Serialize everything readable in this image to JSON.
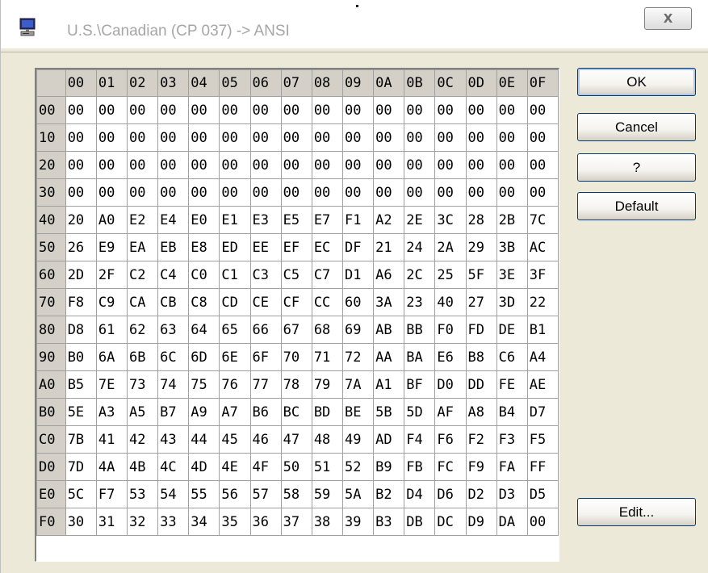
{
  "window": {
    "title": "U.S.\\Canadian (CP 037) -> ANSI",
    "close_label": "X"
  },
  "buttons": {
    "ok": "OK",
    "cancel": "Cancel",
    "help": "?",
    "default": "Default",
    "edit": "Edit..."
  },
  "grid": {
    "columns": [
      "00",
      "01",
      "02",
      "03",
      "04",
      "05",
      "06",
      "07",
      "08",
      "09",
      "0A",
      "0B",
      "0C",
      "0D",
      "0E",
      "0F"
    ],
    "rows": [
      {
        "label": "00",
        "cells": [
          "00",
          "00",
          "00",
          "00",
          "00",
          "00",
          "00",
          "00",
          "00",
          "00",
          "00",
          "00",
          "00",
          "00",
          "00",
          "00"
        ]
      },
      {
        "label": "10",
        "cells": [
          "00",
          "00",
          "00",
          "00",
          "00",
          "00",
          "00",
          "00",
          "00",
          "00",
          "00",
          "00",
          "00",
          "00",
          "00",
          "00"
        ]
      },
      {
        "label": "20",
        "cells": [
          "00",
          "00",
          "00",
          "00",
          "00",
          "00",
          "00",
          "00",
          "00",
          "00",
          "00",
          "00",
          "00",
          "00",
          "00",
          "00"
        ]
      },
      {
        "label": "30",
        "cells": [
          "00",
          "00",
          "00",
          "00",
          "00",
          "00",
          "00",
          "00",
          "00",
          "00",
          "00",
          "00",
          "00",
          "00",
          "00",
          "00"
        ]
      },
      {
        "label": "40",
        "cells": [
          "20",
          "A0",
          "E2",
          "E4",
          "E0",
          "E1",
          "E3",
          "E5",
          "E7",
          "F1",
          "A2",
          "2E",
          "3C",
          "28",
          "2B",
          "7C"
        ]
      },
      {
        "label": "50",
        "cells": [
          "26",
          "E9",
          "EA",
          "EB",
          "E8",
          "ED",
          "EE",
          "EF",
          "EC",
          "DF",
          "21",
          "24",
          "2A",
          "29",
          "3B",
          "AC"
        ]
      },
      {
        "label": "60",
        "cells": [
          "2D",
          "2F",
          "C2",
          "C4",
          "C0",
          "C1",
          "C3",
          "C5",
          "C7",
          "D1",
          "A6",
          "2C",
          "25",
          "5F",
          "3E",
          "3F"
        ]
      },
      {
        "label": "70",
        "cells": [
          "F8",
          "C9",
          "CA",
          "CB",
          "C8",
          "CD",
          "CE",
          "CF",
          "CC",
          "60",
          "3A",
          "23",
          "40",
          "27",
          "3D",
          "22"
        ]
      },
      {
        "label": "80",
        "cells": [
          "D8",
          "61",
          "62",
          "63",
          "64",
          "65",
          "66",
          "67",
          "68",
          "69",
          "AB",
          "BB",
          "F0",
          "FD",
          "DE",
          "B1"
        ]
      },
      {
        "label": "90",
        "cells": [
          "B0",
          "6A",
          "6B",
          "6C",
          "6D",
          "6E",
          "6F",
          "70",
          "71",
          "72",
          "AA",
          "BA",
          "E6",
          "B8",
          "C6",
          "A4"
        ]
      },
      {
        "label": "A0",
        "cells": [
          "B5",
          "7E",
          "73",
          "74",
          "75",
          "76",
          "77",
          "78",
          "79",
          "7A",
          "A1",
          "BF",
          "D0",
          "DD",
          "FE",
          "AE"
        ]
      },
      {
        "label": "B0",
        "cells": [
          "5E",
          "A3",
          "A5",
          "B7",
          "A9",
          "A7",
          "B6",
          "BC",
          "BD",
          "BE",
          "5B",
          "5D",
          "AF",
          "A8",
          "B4",
          "D7"
        ]
      },
      {
        "label": "C0",
        "cells": [
          "7B",
          "41",
          "42",
          "43",
          "44",
          "45",
          "46",
          "47",
          "48",
          "49",
          "AD",
          "F4",
          "F6",
          "F2",
          "F3",
          "F5"
        ]
      },
      {
        "label": "D0",
        "cells": [
          "7D",
          "4A",
          "4B",
          "4C",
          "4D",
          "4E",
          "4F",
          "50",
          "51",
          "52",
          "B9",
          "FB",
          "FC",
          "F9",
          "FA",
          "FF"
        ]
      },
      {
        "label": "E0",
        "cells": [
          "5C",
          "F7",
          "53",
          "54",
          "55",
          "56",
          "57",
          "58",
          "59",
          "5A",
          "B2",
          "D4",
          "D6",
          "D2",
          "D3",
          "D5"
        ]
      },
      {
        "label": "F0",
        "cells": [
          "30",
          "31",
          "32",
          "33",
          "34",
          "35",
          "36",
          "37",
          "38",
          "39",
          "B3",
          "DB",
          "DC",
          "D9",
          "DA",
          "00"
        ]
      }
    ]
  },
  "colors": {
    "title_text": "#a6a6a6",
    "header_bg": "#d4d0c8",
    "dialog_bg": "#ece9d8",
    "button_border": "#003c74"
  },
  "icons": {
    "window": "computer-monitor-icon",
    "close": "close-icon"
  }
}
